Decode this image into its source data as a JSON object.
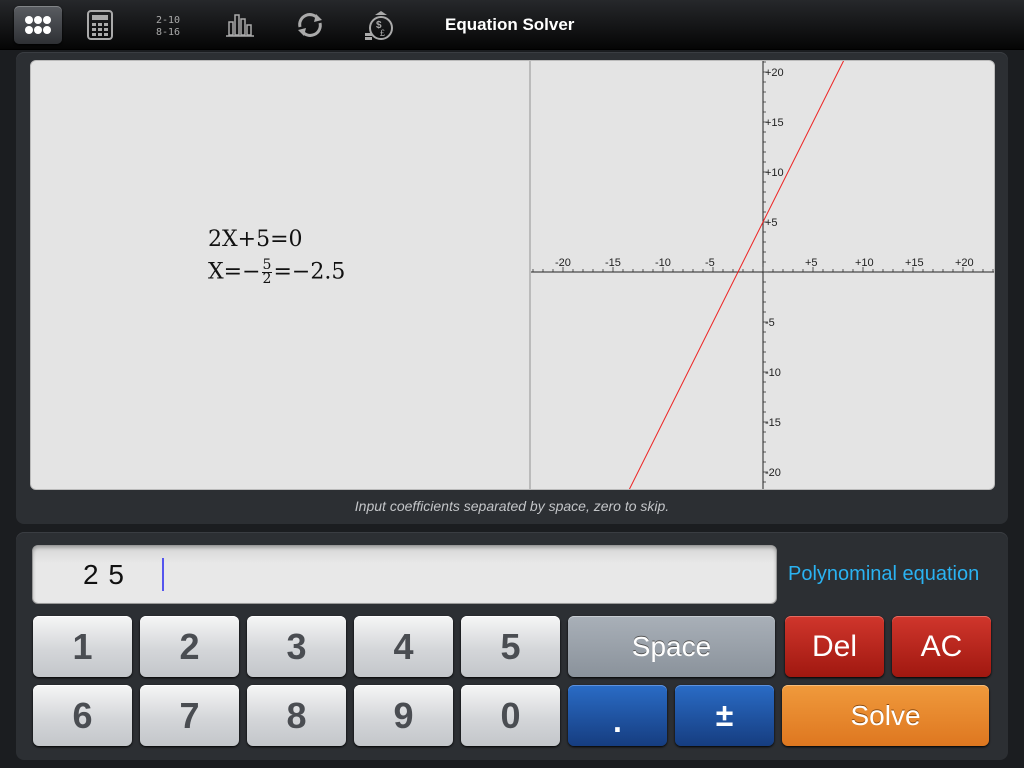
{
  "toolbar": {
    "title": "Equation Solver",
    "icons": [
      "app-menu-icon",
      "calculator-icon",
      "base-converter-icon",
      "statistics-icon",
      "unit-conversion-icon",
      "currency-icon"
    ],
    "active_index": 0
  },
  "output": {
    "equation_lhs": "2X+5",
    "equation_rhs": "0",
    "solution_var": "X",
    "solution_num": "5",
    "solution_den": "2",
    "solution_decimal": "−2.5",
    "hint": "Input coefficients separated by space, zero to skip."
  },
  "graph": {
    "x_ticks": [
      "-20",
      "-15",
      "-10",
      "-5",
      "+5",
      "+10",
      "+15",
      "+20"
    ],
    "y_ticks": [
      "+20",
      "+15",
      "+10",
      "+5",
      "-5",
      "-10",
      "-15",
      "-20"
    ],
    "range": [
      -20,
      20
    ],
    "line_color": "#ee2222",
    "function": "y = 2x + 5"
  },
  "input": {
    "value": "2 5",
    "mode_label": "Polynominal equation"
  },
  "keypad": {
    "k1": "1",
    "k2": "2",
    "k3": "3",
    "k4": "4",
    "k5": "5",
    "k6": "6",
    "k7": "7",
    "k8": "8",
    "k9": "9",
    "k0": "0",
    "space": "Space",
    "del": "Del",
    "ac": "AC",
    "dot": ".",
    "sign": "±",
    "solve": "Solve"
  },
  "colors": {
    "accent_text": "#2ab3f2",
    "del_ac": "#b9231a",
    "blue_keys": "#1f52a0",
    "solve": "#e8882e"
  }
}
